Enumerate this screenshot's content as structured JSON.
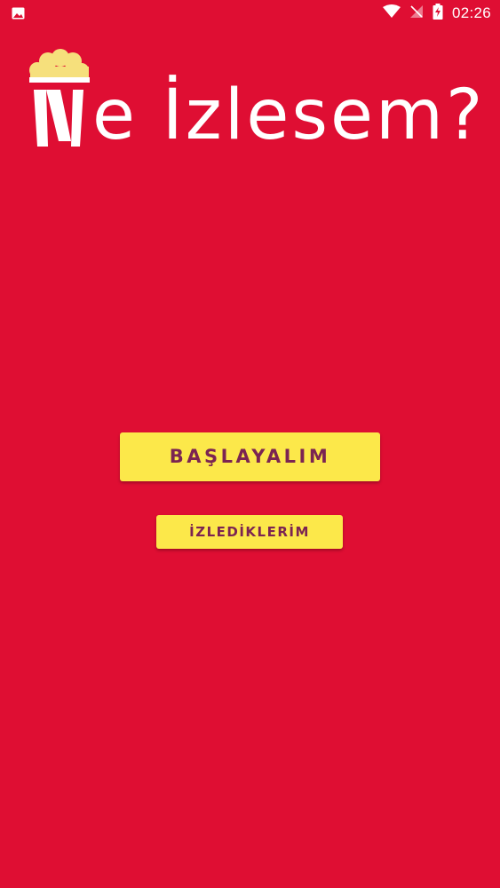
{
  "status_bar": {
    "left_icon": "image-icon",
    "icons": [
      "wifi-icon",
      "no-signal-icon",
      "battery-charging-icon"
    ],
    "time": "02:26"
  },
  "logo": {
    "cup_icon": "popcorn-icon",
    "text": "e İzlesem?"
  },
  "main": {
    "start_button_label": "BAŞLAYALIM",
    "watched_button_label": "İZLEDİKLERİM"
  },
  "colors": {
    "background": "#DF0E33",
    "button_background": "#FCE84A",
    "button_text": "#7B2452",
    "popcorn": "#F6E07C"
  }
}
